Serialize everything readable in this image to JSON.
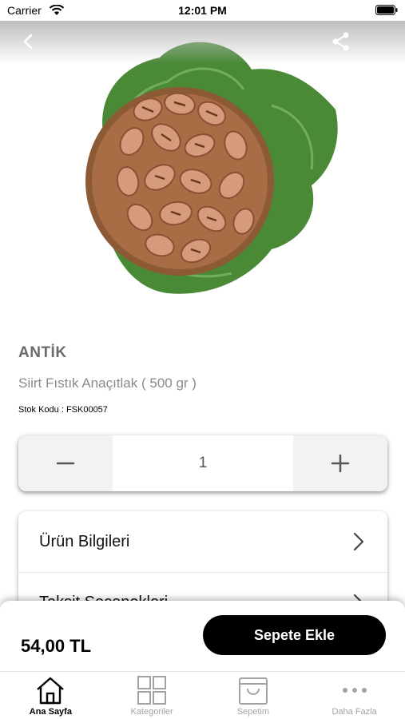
{
  "status_bar": {
    "carrier": "Carrier",
    "time": "12:01 PM"
  },
  "nav": {
    "back_icon": "chevron-left-icon",
    "share_icon": "share-icon"
  },
  "product": {
    "image": "pistachio-bowl-on-leaf",
    "brand": "ANTİK",
    "name": "Siirt Fıstık Anaçıtlak ( 500 gr )",
    "stock_label": "Stok Kodu : ",
    "stock_code": "FSK00057"
  },
  "quantity": {
    "value": "1",
    "minus_icon": "minus-icon",
    "plus_icon": "plus-icon"
  },
  "info_list": [
    {
      "label": "Ürün Bilgileri"
    },
    {
      "label": "Taksit Seçenekleri"
    }
  ],
  "checkout": {
    "price": "54,00 TL",
    "button_label": "Sepete Ekle"
  },
  "tabs": [
    {
      "label": "Ana Sayfa",
      "icon": "home-icon",
      "active": true
    },
    {
      "label": "Kategoriler",
      "icon": "grid-icon",
      "active": false
    },
    {
      "label": "Sepetim",
      "icon": "shopping-bag-icon",
      "active": false
    },
    {
      "label": "Daha Fazla",
      "icon": "more-icon",
      "active": false
    }
  ],
  "colors": {
    "brand_text": "#6b6b6b",
    "button": "#000000",
    "inactive_tab": "#a3a3a3"
  }
}
